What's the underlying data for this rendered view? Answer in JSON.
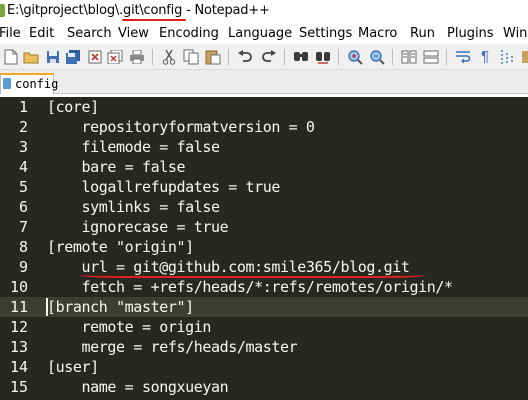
{
  "window": {
    "title": "E:\\gitproject\\blog\\.git\\config - Notepad++"
  },
  "menu": [
    "File",
    "Edit",
    "Search",
    "View",
    "Encoding",
    "Language",
    "Settings",
    "Macro",
    "Run",
    "Plugins",
    "Window"
  ],
  "toolbar": {
    "buttons": [
      "new-file-icon",
      "open-file-icon",
      "save-icon",
      "save-all-icon",
      "close-icon",
      "close-all-icon",
      "print-icon",
      "cut-icon",
      "copy-icon",
      "paste-icon",
      "undo-icon",
      "redo-icon",
      "find-icon",
      "replace-icon",
      "zoom-in-icon",
      "zoom-out-icon",
      "sync-scroll-icon",
      "word-wrap-icon",
      "show-all-chars-icon",
      "indent-guide-icon"
    ]
  },
  "tabs": [
    {
      "label": "config",
      "active": true,
      "icon": "document-icon"
    }
  ],
  "editor": {
    "current_line": 11,
    "lines": [
      {
        "n": "1",
        "text": "[core]"
      },
      {
        "n": "2",
        "text": "    repositoryformatversion = 0"
      },
      {
        "n": "3",
        "text": "    filemode = false"
      },
      {
        "n": "4",
        "text": "    bare = false"
      },
      {
        "n": "5",
        "text": "    logallrefupdates = true"
      },
      {
        "n": "6",
        "text": "    symlinks = false"
      },
      {
        "n": "7",
        "text": "    ignorecase = true"
      },
      {
        "n": "8",
        "text": "[remote \"origin\"]"
      },
      {
        "n": "9",
        "text": "    url = git@github.com:smile365/blog.git"
      },
      {
        "n": "10",
        "text": "    fetch = +refs/heads/*:refs/remotes/origin/*"
      },
      {
        "n": "11",
        "text": "[branch \"master\"]"
      },
      {
        "n": "12",
        "text": "    remote = origin"
      },
      {
        "n": "13",
        "text": "    merge = refs/heads/master"
      },
      {
        "n": "14",
        "text": "[user]"
      },
      {
        "n": "15",
        "text": "    name = songxueyan"
      }
    ]
  },
  "colors": {
    "editor_bg": "#272822",
    "current_line_bg": "#3e3d32",
    "text": "#f8f8f2",
    "annotation": "#e02020",
    "tab_accent": "#f5a623"
  }
}
